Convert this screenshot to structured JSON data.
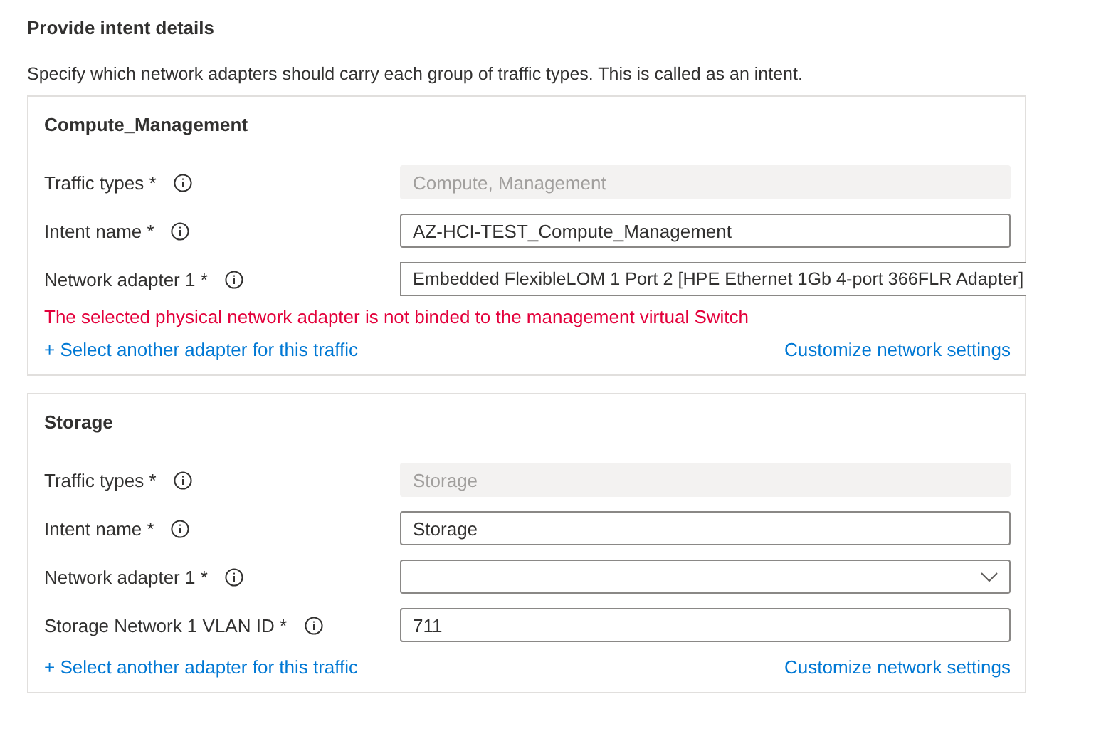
{
  "heading": "Provide intent details",
  "description": "Specify which network adapters should carry each group of traffic types. This is called as an intent.",
  "intents": [
    {
      "title": "Compute_Management",
      "fields": [
        {
          "label": "Traffic types *",
          "kind": "readonly",
          "value": "Compute, Management"
        },
        {
          "label": "Intent name *",
          "kind": "text",
          "value": "AZ-HCI-TEST_Compute_Management"
        },
        {
          "label": "Network adapter 1 *",
          "kind": "overflow",
          "value": "Embedded FlexibleLOM 1 Port 2 [HPE Ethernet 1Gb 4-port 366FLR Adapter]"
        }
      ],
      "error": "The selected physical network adapter is not binded to the management virtual Switch",
      "add_link": "+ Select another adapter for this traffic",
      "customize_link": "Customize network settings"
    },
    {
      "title": "Storage",
      "fields": [
        {
          "label": "Traffic types *",
          "kind": "readonly",
          "value": "Storage"
        },
        {
          "label": "Intent name *",
          "kind": "text",
          "value": "Storage"
        },
        {
          "label": "Network adapter 1 *",
          "kind": "dropdown"
        },
        {
          "label": "Storage Network 1 VLAN ID *",
          "kind": "text",
          "value": "711"
        }
      ],
      "add_link": "+ Select another adapter for this traffic",
      "customize_link": "Customize network settings"
    }
  ]
}
